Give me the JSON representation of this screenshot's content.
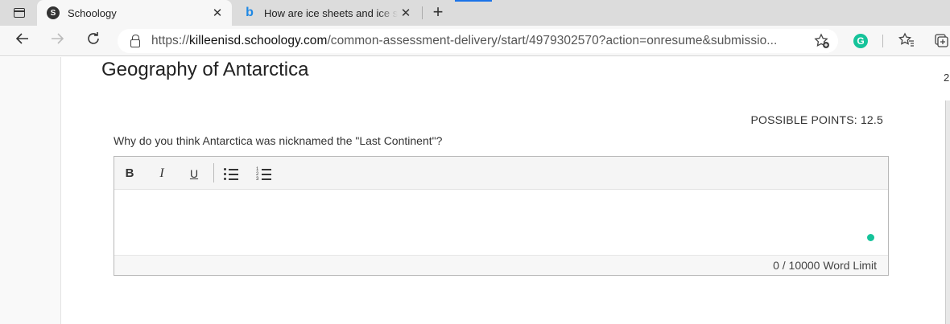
{
  "browser": {
    "tabs": [
      {
        "title": "Schoology",
        "favicon": "schoology-icon",
        "active": true
      },
      {
        "title": "How are ice sheets and ice shelves",
        "favicon": "bing-icon",
        "active": false
      }
    ],
    "new_tab_glyph": "+",
    "close_glyph": "✕",
    "url_prefix": "https://",
    "url_host": "killeenisd.schoology.com",
    "url_path": "/common-assessment-delivery/start/4979302570?action=onresume&submissio..."
  },
  "page": {
    "title": "Geography of Antarctica",
    "right_edge_number": "2",
    "possible_points": "POSSIBLE POINTS: 12.5",
    "question": "Why do you think Antarctica was nicknamed the \"Last Continent\"?",
    "editor": {
      "bold_label": "B",
      "italic_label": "I",
      "underline_label": "U",
      "word_count": "0",
      "word_limit": "/ 10000 Word Limit"
    }
  },
  "colors": {
    "accent": "#1a73e8",
    "grammarly": "#15c39a",
    "bing": "#1e88e5"
  }
}
